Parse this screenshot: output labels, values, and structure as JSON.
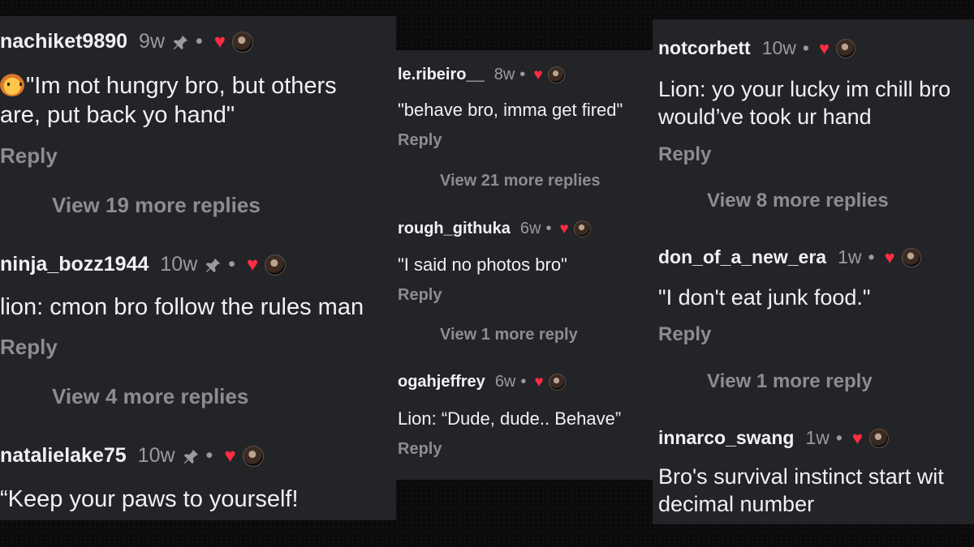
{
  "panels": {
    "left": {
      "comments": [
        {
          "user": "nachiket9890",
          "time": "9w",
          "pinned": true,
          "lines": [
            "\"Im not hungry bro, but others",
            "are, put back yo hand\""
          ],
          "reply": "Reply",
          "more": "View 19 more replies"
        },
        {
          "user": "ninja_bozz1944",
          "time": "10w",
          "pinned": true,
          "lines": [
            "lion: cmon bro follow the rules man"
          ],
          "reply": "Reply",
          "more": "View 4 more replies"
        },
        {
          "user": "natalielake75",
          "time": "10w",
          "pinned": true,
          "lines": [
            "“Keep your paws to yourself!"
          ]
        }
      ]
    },
    "middle": {
      "comments": [
        {
          "user": "le.ribeiro__",
          "time": "8w",
          "lines": [
            "\"behave bro, imma get fired\""
          ],
          "reply": "Reply",
          "more": "View 21 more replies"
        },
        {
          "user": "rough_githuka",
          "time": "6w",
          "lines": [
            "\"I said no photos bro\""
          ],
          "reply": "Reply",
          "more": "View 1 more reply"
        },
        {
          "user": "ogahjeffrey",
          "time": "6w",
          "lines": [
            "Lion: “Dude, dude.. Behave”"
          ],
          "reply": "Reply"
        }
      ]
    },
    "right": {
      "comments": [
        {
          "user": "notcorbett",
          "time": "10w",
          "lines": [
            "Lion: yo your lucky im chill bro",
            "would’ve took ur hand"
          ],
          "reply": "Reply",
          "more": "View 8 more replies"
        },
        {
          "user": "don_of_a_new_era",
          "time": "1w",
          "lines": [
            "\"I don't eat junk food.\""
          ],
          "reply": "Reply",
          "more": "View 1 more reply"
        },
        {
          "user": "innarco_swang",
          "time": "1w",
          "lines": [
            "Bro's survival instinct start wit",
            "decimal number"
          ]
        }
      ]
    }
  },
  "symbols": {
    "dot": "•",
    "heart": "♥",
    "pin": "📌"
  },
  "icons": {
    "pin": "pin-icon",
    "heart": "heart-icon",
    "avatar": "author-avatar",
    "emoji": "lion-emoji-icon"
  },
  "colors": {
    "panel_bg": "#232427",
    "page_bg": "#0b0b0c",
    "heart": "#ff2d43",
    "muted": "#8c8d93"
  }
}
